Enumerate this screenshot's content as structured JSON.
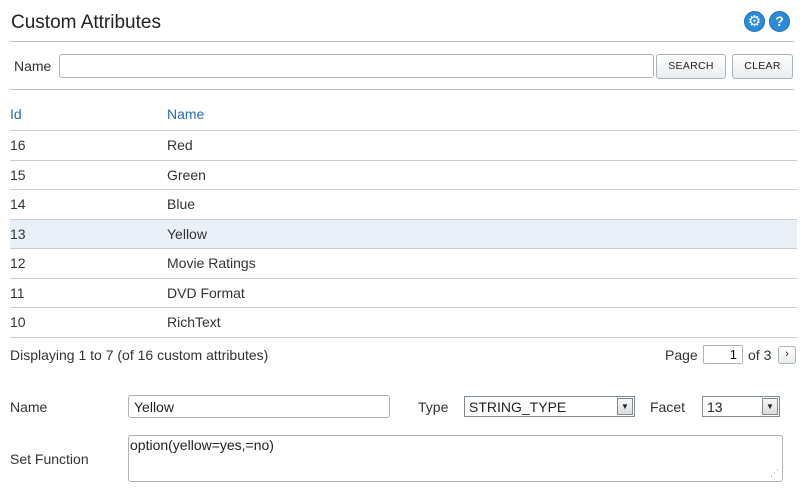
{
  "header": {
    "title": "Custom Attributes",
    "settings_icon": "gear-icon",
    "help_icon": "help-icon",
    "help_glyph": "?",
    "accent_color": "#2d8ad8"
  },
  "search": {
    "label": "Name",
    "value": "",
    "search_button": "SEARCH",
    "clear_button": "CLEAR"
  },
  "grid": {
    "columns": [
      "Id",
      "Name"
    ],
    "rows": [
      {
        "id": "16",
        "name": "Red"
      },
      {
        "id": "15",
        "name": "Green"
      },
      {
        "id": "14",
        "name": "Blue"
      },
      {
        "id": "13",
        "name": "Yellow"
      },
      {
        "id": "12",
        "name": "Movie Ratings"
      },
      {
        "id": "11",
        "name": "DVD Format"
      },
      {
        "id": "10",
        "name": "RichText"
      }
    ],
    "selected_row": 3
  },
  "pager": {
    "info": "Displaying 1 to 7 (of 16 custom attributes)",
    "page_label": "Page",
    "page_value": "1",
    "of_label": "of 3",
    "next_glyph": "›"
  },
  "form": {
    "name_label": "Name",
    "name_value": "Yellow",
    "type_label": "Type",
    "type_value": "STRING_TYPE",
    "facet_label": "Facet",
    "facet_value": "13",
    "set_function_label": "Set Function",
    "set_function_value": "option(yellow=yes,=no)"
  }
}
